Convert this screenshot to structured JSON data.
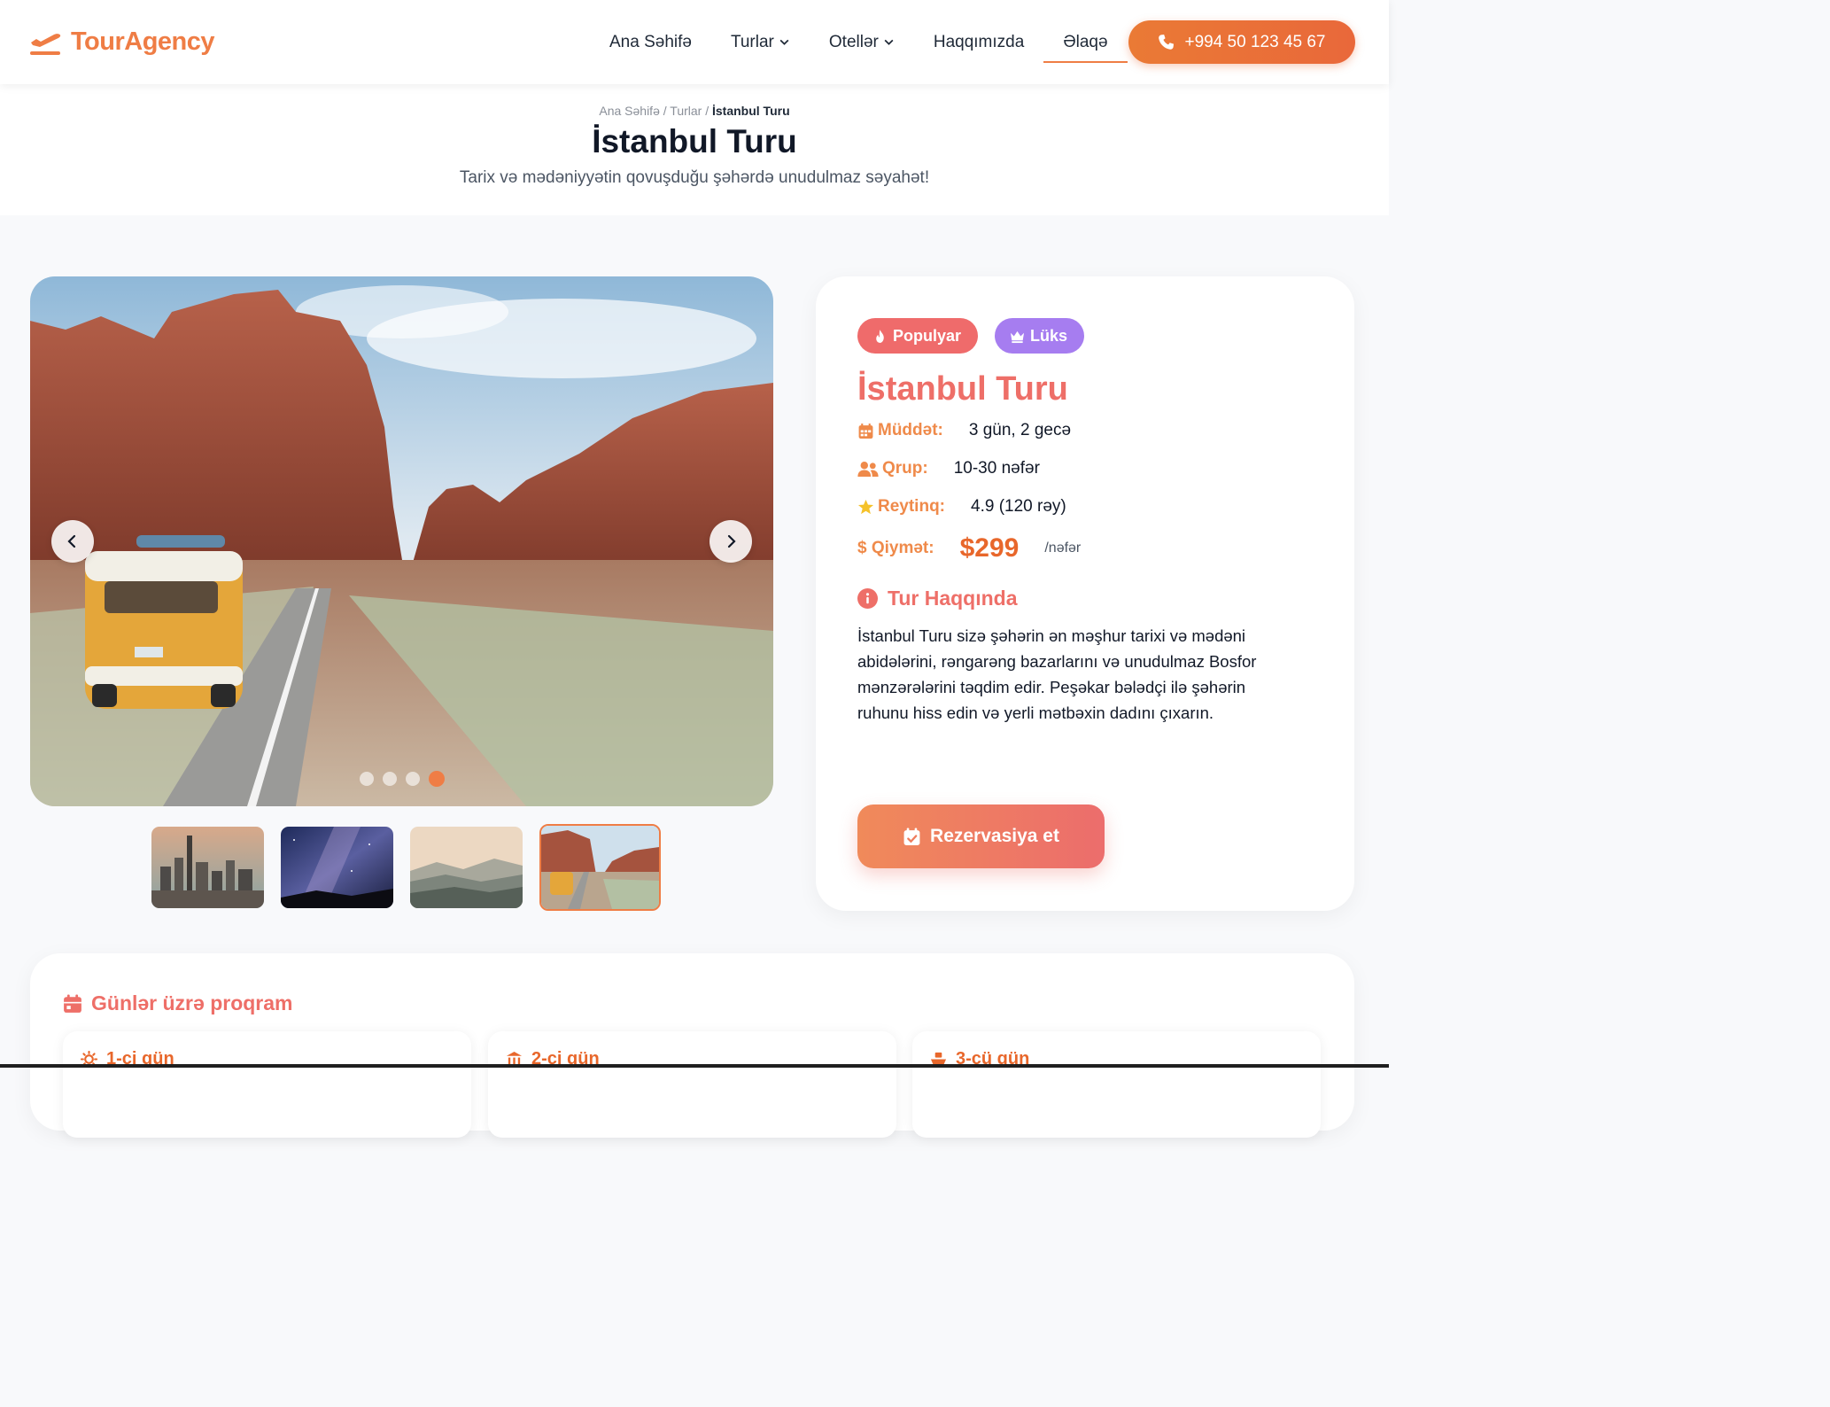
{
  "brand": {
    "name": "TourAgency",
    "color": "#ef7d45",
    "icon": "plane-departure-icon"
  },
  "nav": {
    "items": [
      {
        "label": "Ana Səhifə",
        "dropdown": false,
        "active": false
      },
      {
        "label": "Turlar",
        "dropdown": true,
        "active": false
      },
      {
        "label": "Otellər",
        "dropdown": true,
        "active": false
      },
      {
        "label": "Haqqımızda",
        "dropdown": false,
        "active": false
      },
      {
        "label": "Əlaqə",
        "dropdown": false,
        "active": true
      }
    ],
    "phone": {
      "label": "+994 50 123 45 67",
      "icon": "phone-icon"
    }
  },
  "breadcrumb": {
    "home": "Ana Səhifə",
    "sep1": "/",
    "tours": "Turlar",
    "sep2": "/",
    "current": "İstanbul Turu"
  },
  "hero": {
    "title": "İstanbul Turu",
    "subtitle": "Tarix və mədəniyyətin qovuşduğu şəhərdə unudulmaz səyahət!"
  },
  "gallery": {
    "slide_count": 4,
    "active_slide": 4,
    "thumbnails": [
      {
        "name": "city-skyline",
        "active": false
      },
      {
        "name": "starry-night",
        "active": false
      },
      {
        "name": "misty-mountains",
        "active": false
      },
      {
        "name": "canyon-road-van",
        "active": true
      }
    ]
  },
  "tour": {
    "badges": [
      {
        "label": "Populyar",
        "icon": "fire-icon",
        "color": "#ef6b6b"
      },
      {
        "label": "Lüks",
        "icon": "crown-icon",
        "color": "#a67df0"
      }
    ],
    "title": "İstanbul Turu",
    "duration": {
      "label": "Müddət:",
      "value": "3 gün, 2 gecə",
      "icon": "calendar-icon"
    },
    "group": {
      "label": "Qrup:",
      "value": "10-30 nəfər",
      "icon": "users-icon"
    },
    "rating": {
      "label": "Reytinq:",
      "value": "4.9 (120 rəy)",
      "icon": "star-icon"
    },
    "price": {
      "label": "$ Qiymət:",
      "value": "$299",
      "unit": "/nəfər"
    },
    "about": {
      "title": "Tur Haqqında",
      "icon": "info-icon",
      "text": "İstanbul Turu sizə şəhərin ən məşhur tarixi və mədəni abidələrini, rəngarəng bazarlarını və unudulmaz Bosfor mənzərələrini təqdim edir. Peşəkar bələdçi ilə şəhərin ruhunu hiss edin və yerli mətbəxin dadını çıxarın."
    },
    "book_button": "Rezervasiya et"
  },
  "program": {
    "title": "Günlər üzrə proqram",
    "days": [
      {
        "label": "1-ci gün",
        "icon": "sun-icon"
      },
      {
        "label": "2-ci gün",
        "icon": "landmark-icon"
      },
      {
        "label": "3-cü gün",
        "icon": "ship-icon"
      }
    ]
  }
}
